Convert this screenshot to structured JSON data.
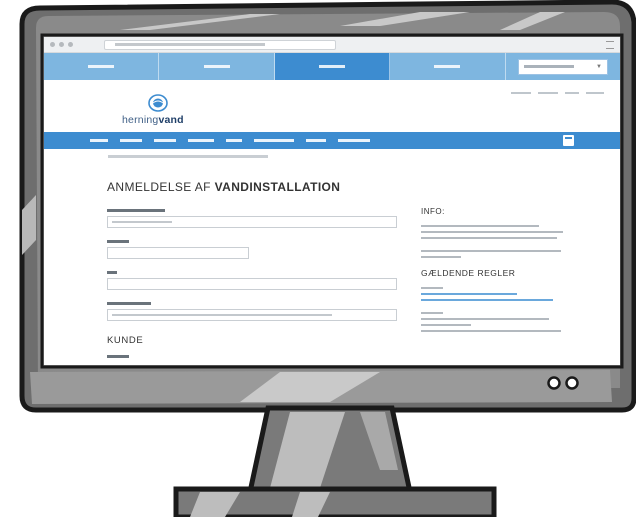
{
  "brand": {
    "logo_part1": "herning",
    "logo_part2": "vand"
  },
  "page": {
    "title_part1": "ANMELDELSE AF ",
    "title_part2": "VANDINSTALLATION",
    "section_customer": "KUNDE"
  },
  "sidebar": {
    "info_title": "INFO:",
    "rules_title": "GÆLDENDE REGLER"
  },
  "colors": {
    "nav_light": "#7eb6e0",
    "nav_active": "#3d8cd0",
    "link": "#6aa8dc",
    "monitor_frame": "#6e6e6e",
    "monitor_outline": "#1a1a1a"
  },
  "icons": [
    "logo-drop-icon",
    "calendar-icon",
    "power-button-icon",
    "menu-icon"
  ]
}
